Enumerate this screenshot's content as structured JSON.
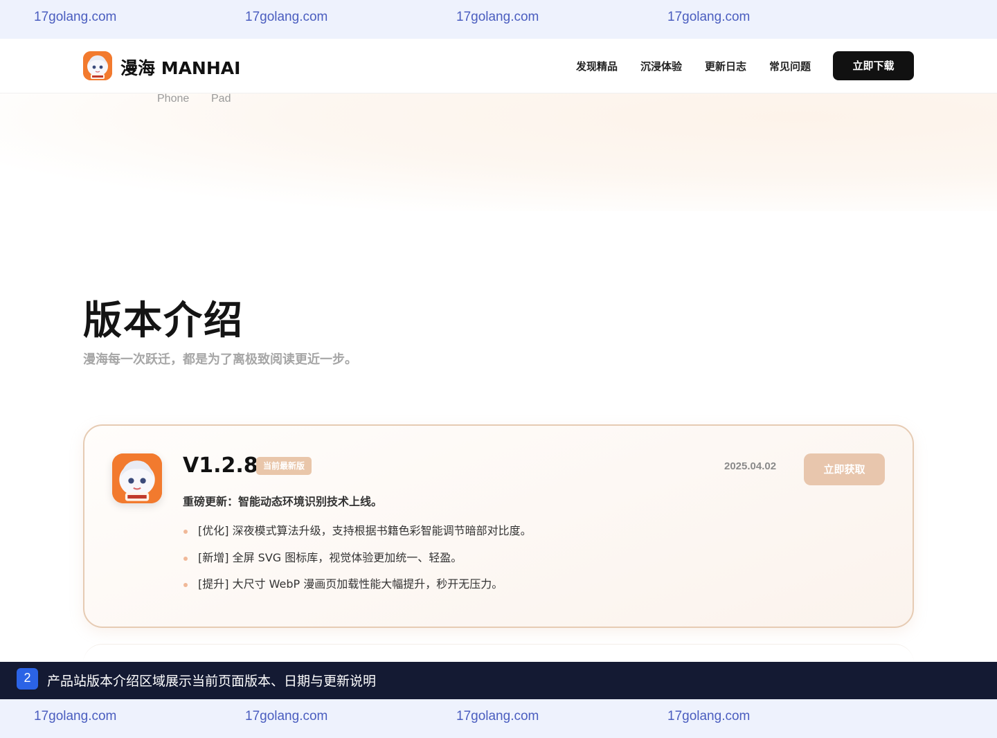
{
  "watermark": {
    "top": [
      "17golang.com",
      "17golang.com",
      "17golang.com",
      "17golang.com"
    ],
    "bottom": [
      "17golang.com",
      "17golang.com",
      "17golang.com",
      "17golang.com"
    ]
  },
  "header": {
    "logo_icon": "manhai-app-icon",
    "brand": "漫海 MANHAI",
    "nav": [
      "发现精品",
      "沉浸体验",
      "更新日志",
      "常见问题"
    ],
    "download_label": "立即下载"
  },
  "hero": {
    "device_tabs": [
      "Phone",
      "Pad"
    ]
  },
  "section": {
    "title": "版本介绍",
    "subtitle": "漫海每一次跃迁，都是为了离极致阅读更近一步。"
  },
  "release": {
    "icon": "manhai-app-icon",
    "version": "V1.2.8",
    "badge": "当前最新版",
    "date": "2025.04.02",
    "get_label": "立即获取",
    "headline": "重磅更新：智能动态环境识别技术上线。",
    "items": [
      "[优化] 深夜模式算法升级，支持根据书籍色彩智能调节暗部对比度。",
      "[新增] 全屏 SVG 图标库，视觉体验更加统一、轻盈。",
      "[提升] 大尺寸 WebP 漫画页加载性能大幅提升，秒开无压力。"
    ]
  },
  "caption": {
    "number": "2",
    "text": "产品站版本介绍区域展示当前页面版本、日期与更新说明"
  },
  "colors": {
    "accent": "#e8c6ad",
    "dark": "#111111",
    "caption_bg": "#141a33",
    "caption_badge": "#2b63e6"
  }
}
